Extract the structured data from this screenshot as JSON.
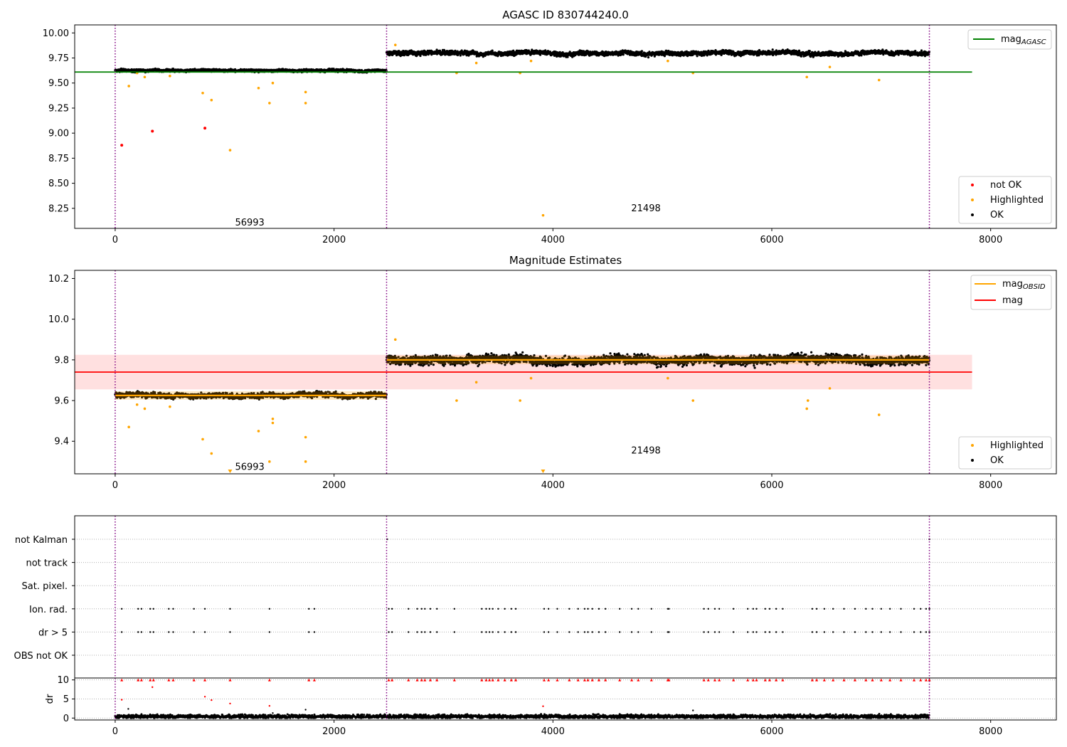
{
  "colors": {
    "ok": "#000000",
    "highlighted": "#ffa500",
    "not_ok": "#ff0000",
    "agasc_line": "#008000",
    "obsid_line": "#ffa500",
    "mag_line": "#ff0000",
    "mag_band": "#ffcccc",
    "obs_boundary": "#800080",
    "flag_grid": "#b0b0b0"
  },
  "chart_data": [
    {
      "type": "scatter",
      "title": "AGASC ID 830744240.0",
      "xlabel": "",
      "ylabel": "",
      "xlim": [
        -370,
        8600
      ],
      "ylim": [
        8.05,
        10.08
      ],
      "xticks": [
        "0",
        "2000",
        "4000",
        "6000",
        "8000"
      ],
      "yticks": [
        "10.00",
        "9.75",
        "9.50",
        "9.25",
        "9.00",
        "8.75",
        "8.50",
        "8.25"
      ],
      "grid": false,
      "legend_upper": {
        "placement": "top-right",
        "entries": [
          "mag_{AGASC}"
        ]
      },
      "legend_lower": {
        "placement": "bottom-right",
        "entries": [
          "not OK",
          "Highlighted",
          "OK"
        ]
      },
      "reference_lines": [
        {
          "name": "mag_{AGASC}",
          "y": 9.61,
          "x_range": [
            -370,
            7830
          ]
        }
      ],
      "observation_boundaries": [
        0,
        2480,
        7440
      ],
      "observation_labels": [
        {
          "text": "56993",
          "x": 1230,
          "y": 8.08
        },
        {
          "text": "21498",
          "x": 4850,
          "y": 8.22
        }
      ],
      "series": [
        {
          "name": "OK",
          "segments": [
            {
              "x_range": [
                0,
                2480
              ],
              "mean": 9.625,
              "spread": 0.015
            },
            {
              "x_range": [
                2480,
                7440
              ],
              "mean": 9.8,
              "spread": 0.025
            }
          ]
        },
        {
          "name": "Highlighted",
          "points": [
            [
              125,
              9.47
            ],
            [
              200,
              9.6
            ],
            [
              270,
              9.56
            ],
            [
              500,
              9.57
            ],
            [
              800,
              9.4
            ],
            [
              880,
              9.33
            ],
            [
              1050,
              8.83
            ],
            [
              1310,
              9.45
            ],
            [
              1410,
              9.3
            ],
            [
              1440,
              9.5
            ],
            [
              1740,
              9.3
            ],
            [
              1740,
              9.41
            ],
            [
              2560,
              9.88
            ],
            [
              3120,
              9.6
            ],
            [
              3300,
              9.7
            ],
            [
              3700,
              9.6
            ],
            [
              3800,
              9.72
            ],
            [
              3910,
              8.18
            ],
            [
              5050,
              9.72
            ],
            [
              5280,
              9.6
            ],
            [
              6320,
              9.56
            ],
            [
              6530,
              9.66
            ],
            [
              6980,
              9.53
            ]
          ]
        },
        {
          "name": "not OK",
          "points": [
            [
              60,
              8.88
            ],
            [
              340,
              9.02
            ],
            [
              820,
              9.05
            ]
          ]
        }
      ]
    },
    {
      "type": "scatter",
      "title": "Magnitude Estimates",
      "xlabel": "",
      "ylabel": "",
      "xlim": [
        -370,
        8600
      ],
      "ylim": [
        9.24,
        10.24
      ],
      "xticks": [
        "0",
        "2000",
        "4000",
        "6000",
        "8000"
      ],
      "yticks": [
        "10.2",
        "10.0",
        "9.8",
        "9.6",
        "9.4"
      ],
      "grid": false,
      "legend_upper": {
        "placement": "top-right",
        "entries": [
          "mag_{OBSID}",
          "mag"
        ]
      },
      "legend_lower": {
        "placement": "bottom-right",
        "entries": [
          "Highlighted",
          "OK"
        ]
      },
      "mag": {
        "value": 9.74,
        "band": [
          9.655,
          9.825
        ],
        "x_range": [
          -370,
          7830
        ]
      },
      "mag_obsid": [
        {
          "x_range": [
            0,
            2480
          ],
          "y": 9.625
        },
        {
          "x_range": [
            2480,
            7440
          ],
          "y": 9.8
        }
      ],
      "observation_boundaries": [
        0,
        2480,
        7440
      ],
      "observation_labels": [
        {
          "text": "56993",
          "x": 1230,
          "y": 9.26
        },
        {
          "text": "21498",
          "x": 4850,
          "y": 9.34
        }
      ],
      "series": [
        {
          "name": "OK",
          "segments": [
            {
              "x_range": [
                0,
                2480
              ],
              "mean": 9.625,
              "spread": 0.015
            },
            {
              "x_range": [
                2480,
                7440
              ],
              "mean": 9.8,
              "spread": 0.025
            }
          ]
        },
        {
          "name": "Highlighted",
          "points": [
            [
              125,
              9.47
            ],
            [
              200,
              9.58
            ],
            [
              270,
              9.56
            ],
            [
              500,
              9.57
            ],
            [
              800,
              9.41
            ],
            [
              880,
              9.34
            ],
            [
              1310,
              9.45
            ],
            [
              1410,
              9.3
            ],
            [
              1440,
              9.51
            ],
            [
              1440,
              9.49
            ],
            [
              1740,
              9.3
            ],
            [
              1740,
              9.42
            ],
            [
              2560,
              9.9
            ],
            [
              3120,
              9.6
            ],
            [
              3300,
              9.69
            ],
            [
              3700,
              9.6
            ],
            [
              3800,
              9.71
            ],
            [
              5050,
              9.71
            ],
            [
              5280,
              9.6
            ],
            [
              6320,
              9.56
            ],
            [
              6330,
              9.6
            ],
            [
              6530,
              9.66
            ],
            [
              6980,
              9.53
            ]
          ]
        },
        {
          "name": "Highlighted (below axis)",
          "points": [
            [
              1050,
              9.24
            ],
            [
              3910,
              9.24
            ]
          ]
        }
      ]
    },
    {
      "type": "scatter",
      "title": "",
      "xlabel": "",
      "ylabel": "",
      "xlim": [
        -370,
        8600
      ],
      "xticks": [
        "0",
        "2000",
        "4000",
        "6000",
        "8000"
      ],
      "categories": [
        "not Kalman",
        "not track",
        "Sat. pixel.",
        "Ion. rad.",
        "dr > 5",
        "OBS not OK"
      ],
      "grid": true,
      "observation_boundaries": [
        0,
        2480,
        7440
      ],
      "flag_events": {
        "x": [
          60,
          210,
          240,
          320,
          350,
          490,
          530,
          720,
          820,
          1050,
          1410,
          1770,
          1820,
          2500,
          2530,
          2680,
          2760,
          2800,
          2830,
          2880,
          2940,
          3100,
          3350,
          3390,
          3420,
          3450,
          3500,
          3560,
          3620,
          3660,
          3920,
          3960,
          4040,
          4150,
          4230,
          4290,
          4320,
          4360,
          4420,
          4480,
          4610,
          4720,
          4780,
          4900,
          5050,
          5060,
          5380,
          5420,
          5480,
          5520,
          5650,
          5780,
          5830,
          5860,
          5940,
          5980,
          6040,
          6100,
          6370,
          6410,
          6480,
          6560,
          6660,
          6760,
          6860,
          6920,
          7000,
          7080,
          7180,
          7300,
          7360,
          7410,
          7440
        ],
        "categories": [
          "Ion. rad.",
          "dr > 5"
        ]
      }
    },
    {
      "type": "scatter",
      "title": "",
      "xlabel": "",
      "ylabel": "dr",
      "xlim": [
        -370,
        8600
      ],
      "ylim": [
        -0.5,
        10.5
      ],
      "xticks": [
        "0",
        "2000",
        "4000",
        "6000",
        "8000"
      ],
      "yticks": [
        "10",
        "5",
        "0"
      ],
      "grid": true,
      "observation_boundaries": [
        0,
        2480,
        7440
      ],
      "series": [
        {
          "name": "dr",
          "mean": 0.4,
          "spread": 0.35,
          "x_range": [
            0,
            7440
          ]
        },
        {
          "name": "dr > 5 (clipped)",
          "y": 10
        },
        {
          "name": "dr outliers",
          "points": [
            [
              60,
              4.8
            ],
            [
              120,
              2.4
            ],
            [
              340,
              8.1
            ],
            [
              820,
              5.6
            ],
            [
              880,
              4.7
            ],
            [
              1050,
              3.8
            ],
            [
              1410,
              3.2
            ],
            [
              1440,
              1.3
            ],
            [
              1740,
              2.2
            ],
            [
              3910,
              3.1
            ],
            [
              5280,
              2.0
            ]
          ]
        }
      ]
    }
  ]
}
